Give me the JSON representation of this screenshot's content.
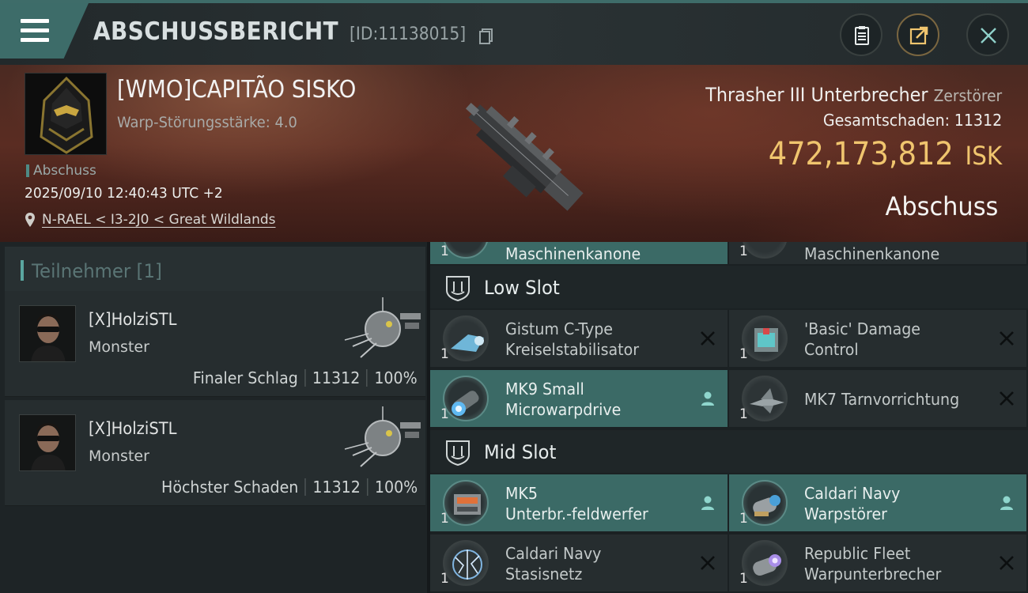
{
  "header": {
    "title": "ABSCHUSSBERICHT",
    "report_id": "[ID:11138015]",
    "buttons": [
      "clipboard-icon",
      "share-icon",
      "close-icon"
    ]
  },
  "victim": {
    "name": "[WMO]CAPITÃO SISKO",
    "warp_strength": "Warp-Störungsstärke: 4.0",
    "tag": "Abschuss",
    "datetime": "2025/09/10 12:40:43 UTC +2",
    "location": "N-RAEL < I3-2J0 < Great Wildlands",
    "ship_name": "Thrasher III Unterbrecher",
    "ship_class": "Zerstörer",
    "damage_label": "Gesamtschaden:",
    "damage_value": "11312",
    "isk_value": "472,173,812",
    "isk_unit": "ISK",
    "result": "Abschuss"
  },
  "participants": {
    "title": "Teilnehmer",
    "count": "[1]",
    "cards": [
      {
        "name": "[X]HolziSTL",
        "ship": "Monster",
        "role": "Finaler Schlag",
        "damage": "11312",
        "percent": "100%"
      },
      {
        "name": "[X]HolziSTL",
        "ship": "Monster",
        "role": "Höchster Schaden",
        "damage": "11312",
        "percent": "100%"
      }
    ]
  },
  "modules": {
    "top_row": [
      {
        "name": "Maschinenkanone",
        "qty": "1",
        "active": true
      },
      {
        "name": "Maschinenkanone",
        "qty": "1",
        "active": false
      }
    ],
    "low_slot_label": "Low Slot",
    "low_slot": [
      {
        "line1": "Gistum C-Type",
        "line2": "Kreiselstabilisator",
        "qty": "1",
        "active": false,
        "state": "destroyed"
      },
      {
        "line1": "'Basic' Damage",
        "line2": "Control",
        "qty": "1",
        "active": false,
        "state": "destroyed"
      },
      {
        "line1": "MK9 Small",
        "line2": "Microwarpdrive",
        "qty": "1",
        "active": true,
        "state": "dropped"
      },
      {
        "line1": "MK7 Tarnvorrichtung",
        "line2": "",
        "qty": "1",
        "active": false,
        "state": "destroyed"
      }
    ],
    "mid_slot_label": "Mid Slot",
    "mid_slot": [
      {
        "line1": "MK5",
        "line2": "Unterbr.-feldwerfer",
        "qty": "1",
        "active": true,
        "state": "dropped"
      },
      {
        "line1": "Caldari Navy",
        "line2": "Warpstörer",
        "qty": "1",
        "active": true,
        "state": "dropped"
      },
      {
        "line1": "Caldari Navy",
        "line2": "Stasisnetz",
        "qty": "1",
        "active": false,
        "state": "destroyed"
      },
      {
        "line1": "Republic Fleet",
        "line2": "Warpunterbrecher",
        "qty": "1",
        "active": false,
        "state": "destroyed"
      }
    ]
  },
  "colors": {
    "accent_teal": "#3b6a66",
    "isk_gold": "#f0c56e",
    "panel": "#262d2f"
  }
}
